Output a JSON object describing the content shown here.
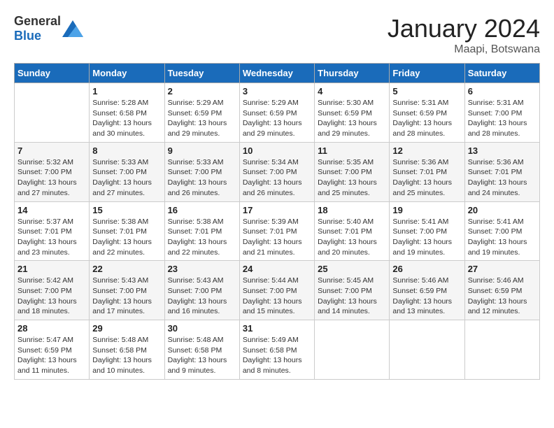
{
  "header": {
    "logo_general": "General",
    "logo_blue": "Blue",
    "month_title": "January 2024",
    "location": "Maapi, Botswana"
  },
  "days_of_week": [
    "Sunday",
    "Monday",
    "Tuesday",
    "Wednesday",
    "Thursday",
    "Friday",
    "Saturday"
  ],
  "weeks": [
    [
      {
        "day": "",
        "info": ""
      },
      {
        "day": "1",
        "info": "Sunrise: 5:28 AM\nSunset: 6:58 PM\nDaylight: 13 hours\nand 30 minutes."
      },
      {
        "day": "2",
        "info": "Sunrise: 5:29 AM\nSunset: 6:59 PM\nDaylight: 13 hours\nand 29 minutes."
      },
      {
        "day": "3",
        "info": "Sunrise: 5:29 AM\nSunset: 6:59 PM\nDaylight: 13 hours\nand 29 minutes."
      },
      {
        "day": "4",
        "info": "Sunrise: 5:30 AM\nSunset: 6:59 PM\nDaylight: 13 hours\nand 29 minutes."
      },
      {
        "day": "5",
        "info": "Sunrise: 5:31 AM\nSunset: 6:59 PM\nDaylight: 13 hours\nand 28 minutes."
      },
      {
        "day": "6",
        "info": "Sunrise: 5:31 AM\nSunset: 7:00 PM\nDaylight: 13 hours\nand 28 minutes."
      }
    ],
    [
      {
        "day": "7",
        "info": "Sunrise: 5:32 AM\nSunset: 7:00 PM\nDaylight: 13 hours\nand 27 minutes."
      },
      {
        "day": "8",
        "info": "Sunrise: 5:33 AM\nSunset: 7:00 PM\nDaylight: 13 hours\nand 27 minutes."
      },
      {
        "day": "9",
        "info": "Sunrise: 5:33 AM\nSunset: 7:00 PM\nDaylight: 13 hours\nand 26 minutes."
      },
      {
        "day": "10",
        "info": "Sunrise: 5:34 AM\nSunset: 7:00 PM\nDaylight: 13 hours\nand 26 minutes."
      },
      {
        "day": "11",
        "info": "Sunrise: 5:35 AM\nSunset: 7:00 PM\nDaylight: 13 hours\nand 25 minutes."
      },
      {
        "day": "12",
        "info": "Sunrise: 5:36 AM\nSunset: 7:01 PM\nDaylight: 13 hours\nand 25 minutes."
      },
      {
        "day": "13",
        "info": "Sunrise: 5:36 AM\nSunset: 7:01 PM\nDaylight: 13 hours\nand 24 minutes."
      }
    ],
    [
      {
        "day": "14",
        "info": "Sunrise: 5:37 AM\nSunset: 7:01 PM\nDaylight: 13 hours\nand 23 minutes."
      },
      {
        "day": "15",
        "info": "Sunrise: 5:38 AM\nSunset: 7:01 PM\nDaylight: 13 hours\nand 22 minutes."
      },
      {
        "day": "16",
        "info": "Sunrise: 5:38 AM\nSunset: 7:01 PM\nDaylight: 13 hours\nand 22 minutes."
      },
      {
        "day": "17",
        "info": "Sunrise: 5:39 AM\nSunset: 7:01 PM\nDaylight: 13 hours\nand 21 minutes."
      },
      {
        "day": "18",
        "info": "Sunrise: 5:40 AM\nSunset: 7:01 PM\nDaylight: 13 hours\nand 20 minutes."
      },
      {
        "day": "19",
        "info": "Sunrise: 5:41 AM\nSunset: 7:00 PM\nDaylight: 13 hours\nand 19 minutes."
      },
      {
        "day": "20",
        "info": "Sunrise: 5:41 AM\nSunset: 7:00 PM\nDaylight: 13 hours\nand 19 minutes."
      }
    ],
    [
      {
        "day": "21",
        "info": "Sunrise: 5:42 AM\nSunset: 7:00 PM\nDaylight: 13 hours\nand 18 minutes."
      },
      {
        "day": "22",
        "info": "Sunrise: 5:43 AM\nSunset: 7:00 PM\nDaylight: 13 hours\nand 17 minutes."
      },
      {
        "day": "23",
        "info": "Sunrise: 5:43 AM\nSunset: 7:00 PM\nDaylight: 13 hours\nand 16 minutes."
      },
      {
        "day": "24",
        "info": "Sunrise: 5:44 AM\nSunset: 7:00 PM\nDaylight: 13 hours\nand 15 minutes."
      },
      {
        "day": "25",
        "info": "Sunrise: 5:45 AM\nSunset: 7:00 PM\nDaylight: 13 hours\nand 14 minutes."
      },
      {
        "day": "26",
        "info": "Sunrise: 5:46 AM\nSunset: 6:59 PM\nDaylight: 13 hours\nand 13 minutes."
      },
      {
        "day": "27",
        "info": "Sunrise: 5:46 AM\nSunset: 6:59 PM\nDaylight: 13 hours\nand 12 minutes."
      }
    ],
    [
      {
        "day": "28",
        "info": "Sunrise: 5:47 AM\nSunset: 6:59 PM\nDaylight: 13 hours\nand 11 minutes."
      },
      {
        "day": "29",
        "info": "Sunrise: 5:48 AM\nSunset: 6:58 PM\nDaylight: 13 hours\nand 10 minutes."
      },
      {
        "day": "30",
        "info": "Sunrise: 5:48 AM\nSunset: 6:58 PM\nDaylight: 13 hours\nand 9 minutes."
      },
      {
        "day": "31",
        "info": "Sunrise: 5:49 AM\nSunset: 6:58 PM\nDaylight: 13 hours\nand 8 minutes."
      },
      {
        "day": "",
        "info": ""
      },
      {
        "day": "",
        "info": ""
      },
      {
        "day": "",
        "info": ""
      }
    ]
  ]
}
